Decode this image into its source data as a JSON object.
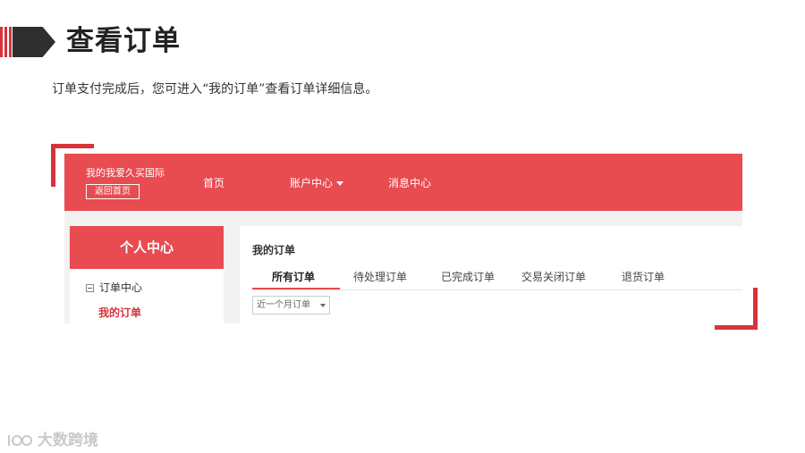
{
  "slide": {
    "title": "查看订单",
    "subtitle": "订单支付完成后，您可进入“我的订单”查看订单详细信息。"
  },
  "screenshot": {
    "header": {
      "brand": "我的我爱久买国际",
      "home_button": "返回首页",
      "nav": {
        "home": "首页",
        "account": "账户中心",
        "messages": "消息中心"
      }
    },
    "sidebar": {
      "title": "个人中心",
      "group": "订单中心",
      "active_link": "我的订单"
    },
    "content": {
      "title": "我的订单",
      "tabs": [
        {
          "label": "所有订单"
        },
        {
          "label": "待处理订单"
        },
        {
          "label": "已完成订单"
        },
        {
          "label": "交易关闭订单"
        },
        {
          "label": "退货订单"
        }
      ],
      "active_tab": "所有订单",
      "filter": "近一个月订单"
    }
  },
  "watermark": {
    "logo_text": "ICO",
    "text": "大数跨境"
  },
  "colors": {
    "accent": "#e84b50",
    "corner": "#d7333b",
    "title_arrow": "#2f2f2f"
  }
}
